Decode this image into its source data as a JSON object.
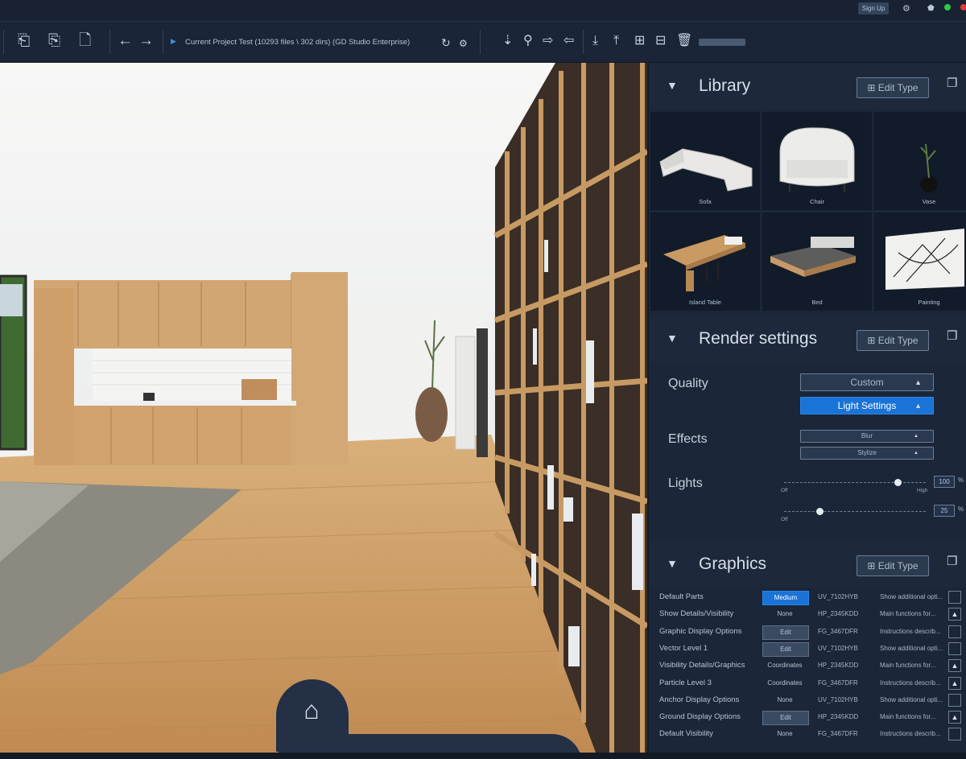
{
  "titlebar": {
    "signin_label": "Sign Up",
    "icons": [
      "gear-icon",
      "pentagon-icon"
    ],
    "window_dots": [
      "#2ecc40",
      "#e53935"
    ]
  },
  "toolbar": {
    "project_label": "Current Project Test  (10293 files \\ 302 dirs) (GD Studio Enterprise)"
  },
  "library": {
    "title": "Library",
    "edit_label": "Edit Type",
    "items": [
      {
        "label": "Sofa"
      },
      {
        "label": "Chair"
      },
      {
        "label": "Vase"
      },
      {
        "label": "Island Table"
      },
      {
        "label": "Bed"
      },
      {
        "label": "Painting"
      }
    ]
  },
  "render": {
    "title": "Render settings",
    "edit_label": "Edit Type",
    "quality_label": "Quality",
    "quality_value": "Custom",
    "light_settings_label": "Light Settings",
    "effects_label": "Effects",
    "effect_1": "Blur",
    "effect_2": "Stylize",
    "lights_label": "Lights",
    "slider1": {
      "value": "100",
      "min_label": "Off",
      "max_label": "High",
      "level": 0.8
    },
    "slider2": {
      "value": "25",
      "min_label": "Off",
      "level": 0.25
    },
    "pct": "%"
  },
  "graphics": {
    "title": "Graphics",
    "edit_label": "Edit Type",
    "rows": [
      {
        "name": "Default Parts",
        "value": "Medium",
        "code": "UV_7102HYB",
        "desc": "Show additional opti...",
        "mark": ""
      },
      {
        "name": "Show Details/Visibility",
        "value": "None",
        "code": "HP_2345KDD",
        "desc": "Main functions for...",
        "mark": "▲"
      },
      {
        "name": "Graphic Display Options",
        "value": "Edit",
        "code": "FG_3467DFR",
        "desc": "Instructions describ...",
        "mark": ""
      },
      {
        "name": "Vector Level 1",
        "value": "Edit",
        "code": "UV_7102HYB",
        "desc": "Show additional opti...",
        "mark": ""
      },
      {
        "name": "Visibility Details/Graphics",
        "value": "Coordinates",
        "code": "HP_2345KDD",
        "desc": "Main functions for...",
        "mark": "▲"
      },
      {
        "name": "Particle Level 3",
        "value": "Coordinates",
        "code": "FG_3467DFR",
        "desc": "Instructions describ...",
        "mark": "▲"
      },
      {
        "name": "Anchor Display Options",
        "value": "None",
        "code": "UV_7102HYB",
        "desc": "Show additional opti...",
        "mark": ""
      },
      {
        "name": "Ground Display Options",
        "value": "Edit",
        "code": "HP_2345KDD",
        "desc": "Main functions for...",
        "mark": "▲"
      },
      {
        "name": "Default Visibility",
        "value": "None",
        "code": "FG_3467DFR",
        "desc": "Instructions describ...",
        "mark": ""
      }
    ]
  },
  "colors": {
    "accent": "#1a73d6",
    "panel_bg": "#1b2638",
    "wood": "#c99a62"
  }
}
